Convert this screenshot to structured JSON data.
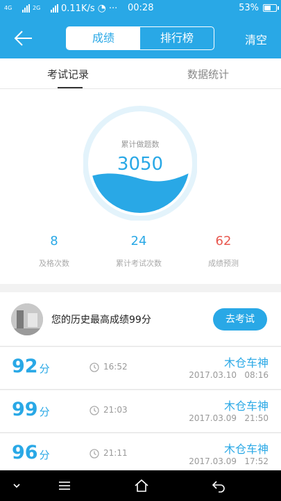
{
  "status_bar": {
    "net_label_top": "4G",
    "net_label_bottom": "2G",
    "speed": "0.11K/s",
    "dots": "···",
    "time": "00:28",
    "battery": "53%"
  },
  "header": {
    "tabs": [
      "成绩",
      "排行榜"
    ],
    "clear_label": "清空"
  },
  "sub_tabs": [
    "考试记录",
    "数据统计"
  ],
  "gauge": {
    "label": "累计做题数",
    "value": "3050",
    "fill_fraction": 0.4
  },
  "stats": [
    {
      "value": "8",
      "label": "及格次数",
      "color": "#29a8e6"
    },
    {
      "value": "24",
      "label": "累计考试次数",
      "color": "#29a8e6"
    },
    {
      "value": "62",
      "label": "成绩预测",
      "color": "#e8584f"
    }
  ],
  "best": {
    "text": "您的历史最高成绩99分",
    "button": "去考试"
  },
  "records": [
    {
      "score": "92",
      "unit": "分",
      "duration": "16:52",
      "name": "木仓车神",
      "date": "2017.03.10   08:16"
    },
    {
      "score": "99",
      "unit": "分",
      "duration": "21:03",
      "name": "木仓车神",
      "date": "2017.03.09   21:50"
    },
    {
      "score": "96",
      "unit": "分",
      "duration": "21:11",
      "name": "木仓车神",
      "date": "2017.03.09   17:52"
    }
  ],
  "colors": {
    "accent": "#29a8e6",
    "predict": "#e8584f"
  },
  "icons": [
    "back-arrow-icon",
    "clock-icon",
    "nav-collapse-icon",
    "nav-menu-icon",
    "nav-home-icon",
    "nav-back-icon"
  ]
}
